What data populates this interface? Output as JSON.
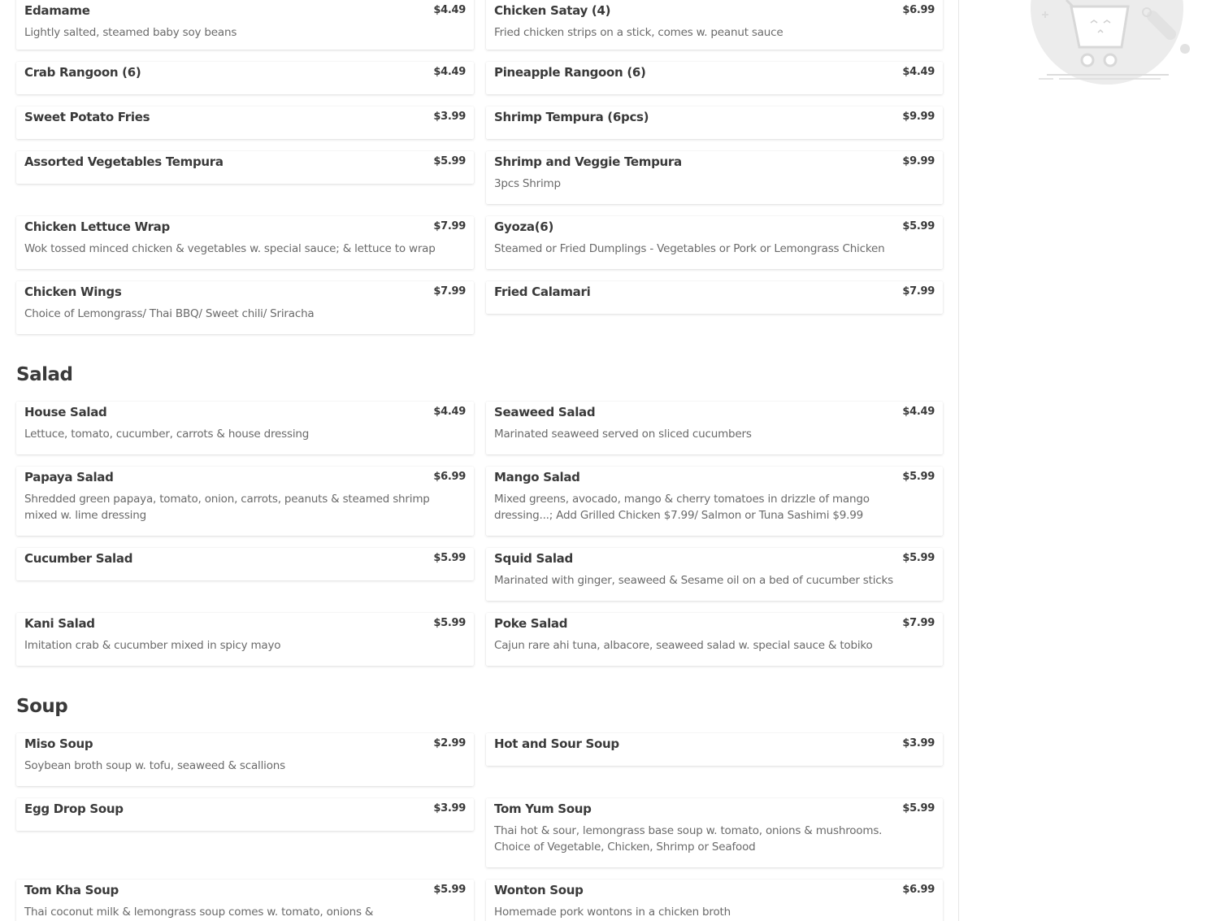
{
  "sections": {
    "appetizers": {
      "items": [
        {
          "name": "Edamame",
          "price": "$4.49",
          "description": "Lightly salted, steamed baby soy beans"
        },
        {
          "name": "Chicken Satay (4)",
          "price": "$6.99",
          "description": "Fried chicken strips on a stick, comes w. peanut sauce"
        },
        {
          "name": "Crab Rangoon (6)",
          "price": "$4.49",
          "description": ""
        },
        {
          "name": "Pineapple Rangoon (6)",
          "price": "$4.49",
          "description": ""
        },
        {
          "name": "Sweet Potato Fries",
          "price": "$3.99",
          "description": ""
        },
        {
          "name": "Shrimp Tempura (6pcs)",
          "price": "$9.99",
          "description": ""
        },
        {
          "name": "Assorted Vegetables Tempura",
          "price": "$5.99",
          "description": ""
        },
        {
          "name": "Shrimp and Veggie Tempura",
          "price": "$9.99",
          "description": "3pcs Shrimp"
        },
        {
          "name": "Chicken Lettuce Wrap",
          "price": "$7.99",
          "description": "Wok tossed minced chicken & vegetables w. special sauce; & lettuce to wrap"
        },
        {
          "name": "Gyoza(6)",
          "price": "$5.99",
          "description": "Steamed or Fried Dumplings - Vegetables or Pork or Lemongrass Chicken"
        },
        {
          "name": "Chicken Wings",
          "price": "$7.99",
          "description": "Choice of Lemongrass/ Thai BBQ/ Sweet chili/ Sriracha"
        },
        {
          "name": "Fried Calamari",
          "price": "$7.99",
          "description": ""
        }
      ]
    },
    "salad": {
      "title": "Salad",
      "items": [
        {
          "name": "House Salad",
          "price": "$4.49",
          "description": "Lettuce, tomato, cucumber, carrots & house dressing"
        },
        {
          "name": "Seaweed Salad",
          "price": "$4.49",
          "description": "Marinated seaweed served on sliced cucumbers"
        },
        {
          "name": "Papaya Salad",
          "price": "$6.99",
          "description": "Shredded green papaya, tomato, onion, carrots, peanuts & steamed shrimp mixed w. lime dressing"
        },
        {
          "name": "Mango Salad",
          "price": "$5.99",
          "description": "Mixed greens, avocado, mango & cherry tomatoes in drizzle of mango dressing...; Add Grilled Chicken $7.99/ Salmon or Tuna Sashimi $9.99"
        },
        {
          "name": "Cucumber Salad",
          "price": "$5.99",
          "description": ""
        },
        {
          "name": "Squid Salad",
          "price": "$5.99",
          "description": "Marinated with ginger, seaweed & Sesame oil on a bed of cucumber sticks"
        },
        {
          "name": "Kani Salad",
          "price": "$5.99",
          "description": "Imitation crab & cucumber mixed in spicy mayo"
        },
        {
          "name": "Poke Salad",
          "price": "$7.99",
          "description": "Cajun rare ahi tuna, albacore, seaweed salad w. special sauce & tobiko"
        }
      ]
    },
    "soup": {
      "title": "Soup",
      "items": [
        {
          "name": "Miso Soup",
          "price": "$2.99",
          "description": "Soybean broth soup w. tofu, seaweed & scallions"
        },
        {
          "name": "Hot and Sour Soup",
          "price": "$3.99",
          "description": ""
        },
        {
          "name": "Egg Drop Soup",
          "price": "$3.99",
          "description": ""
        },
        {
          "name": "Tom Yum Soup",
          "price": "$5.99",
          "description": "Thai hot & sour, lemongrass base soup w. tomato, onions & mushrooms. Choice of Vegetable, Chicken, Shrimp or Seafood"
        },
        {
          "name": "Tom Kha Soup",
          "price": "$5.99",
          "description": "Thai coconut milk & lemongrass soup comes w. tomato, onions &"
        },
        {
          "name": "Wonton Soup",
          "price": "$6.99",
          "description": "Homemade pork wontons in a chicken broth"
        }
      ]
    }
  },
  "sidebar": {
    "cart_icon": "empty-cart-illustration"
  },
  "colors": {
    "text": "#3a3a3a",
    "description": "#6a6a6a",
    "card_bg": "#ffffff",
    "illustration": "#e5e5e5"
  }
}
